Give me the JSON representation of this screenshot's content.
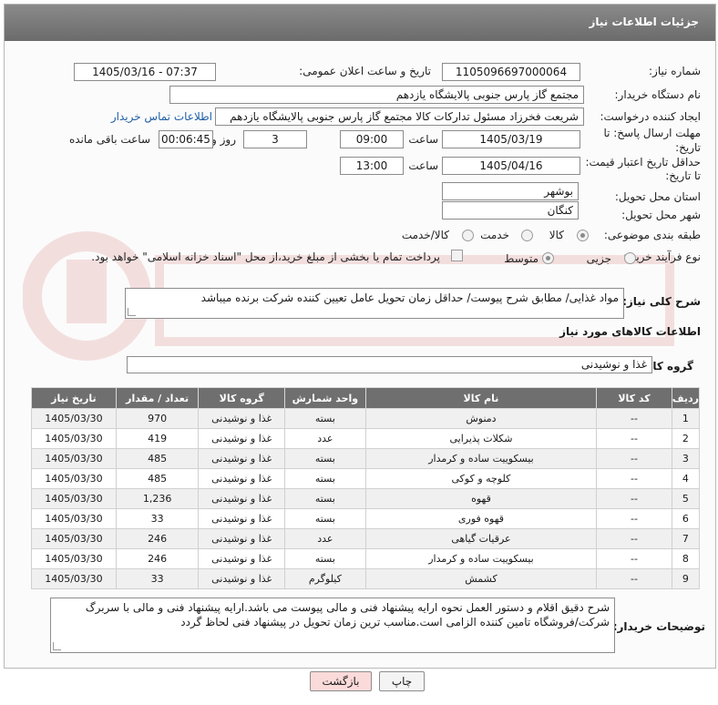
{
  "header": {
    "title": "جزئیات اطلاعات نیاز"
  },
  "form": {
    "need_number_label": "شماره نیاز:",
    "need_number": "1105096697000064",
    "announce_label": "تاریخ و ساعت اعلان عمومی:",
    "announce_value": "1405/03/16 - 07:37",
    "buyer_label": "نام دستگاه خریدار:",
    "buyer_value": "مجتمع گاز پارس جنوبی  پالایشگاه یازدهم",
    "creator_label": "ایجاد کننده درخواست:",
    "creator_value": "شریعت فخرزاد مسئول تدارکات کالا مجتمع گاز پارس جنوبی  پالایشگاه یازدهم",
    "contact_link": "اطلاعات تماس خریدار",
    "deadline_label_1": "مهلت ارسال پاسخ: تا",
    "deadline_label_2": "تاریخ:",
    "deadline_date": "1405/03/19",
    "time_label": "ساعت",
    "deadline_time": "09:00",
    "days_value": "3",
    "days_label": "روز و",
    "remaining_value": "00:06:45",
    "remaining_label": "ساعت باقی مانده",
    "validity_label_1": "حداقل تاریخ اعتبار قیمت:",
    "validity_label_2": "تا تاریخ:",
    "validity_date": "1405/04/16",
    "validity_time": "13:00",
    "province_label": "استان محل تحویل:",
    "province_value": "بوشهر",
    "city_label": "شهر محل تحویل:",
    "city_value": "کنگان",
    "category_label": "طبقه بندی موضوعی:",
    "category_options": [
      "کالا",
      "خدمت",
      "کالا/خدمت"
    ],
    "process_label": "نوع فرآیند خرید :",
    "process_options": [
      "جزیی",
      "متوسط"
    ],
    "payment_note": "پرداخت تمام یا بخشی از مبلغ خرید،از محل \"اسناد خزانه اسلامی\" خواهد بود."
  },
  "summary": {
    "label": "شرح کلی نیاز:",
    "value": "مواد غذایی/ مطابق شرح پیوست/ حداقل زمان تحویل عامل تعیین کننده شرکت برنده میباشد"
  },
  "goods": {
    "section_title": "اطلاعات کالاهای مورد نیاز",
    "group_label": "گروه کالا:",
    "group_value": "غذا و نوشیدنی",
    "columns": [
      "ردیف",
      "کد کالا",
      "نام کالا",
      "واحد شمارش",
      "گروه کالا",
      "تعداد / مقدار",
      "تاریخ نیاز"
    ],
    "rows": [
      [
        "1",
        "--",
        "دمنوش",
        "بسته",
        "غذا و نوشیدنی",
        "970",
        "1405/03/30"
      ],
      [
        "2",
        "--",
        "شکلات پذیرایی",
        "عدد",
        "غذا و نوشیدنی",
        "419",
        "1405/03/30"
      ],
      [
        "3",
        "--",
        "بیسکوییت ساده و کرمدار",
        "بسته",
        "غذا و نوشیدنی",
        "485",
        "1405/03/30"
      ],
      [
        "4",
        "--",
        "کلوچه و کوکی",
        "بسته",
        "غذا و نوشیدنی",
        "485",
        "1405/03/30"
      ],
      [
        "5",
        "--",
        "قهوه",
        "بسته",
        "غذا و نوشیدنی",
        "1,236",
        "1405/03/30"
      ],
      [
        "6",
        "--",
        "قهوه فوری",
        "بسته",
        "غذا و نوشیدنی",
        "33",
        "1405/03/30"
      ],
      [
        "7",
        "--",
        "عرقیات گیاهی",
        "عدد",
        "غذا و نوشیدنی",
        "246",
        "1405/03/30"
      ],
      [
        "8",
        "--",
        "بیسکوییت ساده و کرمدار",
        "بسته",
        "غذا و نوشیدنی",
        "246",
        "1405/03/30"
      ],
      [
        "9",
        "--",
        "کشمش",
        "کیلوگرم",
        "غذا و نوشیدنی",
        "33",
        "1405/03/30"
      ]
    ]
  },
  "buyer_notes": {
    "label": "توضیحات خریدار:",
    "value": "شرح دقیق اقلام و دستور العمل نحوه ارایه پیشنهاد فنی و مالی پیوست می باشد.ارایه پیشنهاد فنی و مالی با سربرگ شرکت/فروشگاه تامین کننده الزامی است.مناسب ترین زمان تحویل در پیشنهاد فنی لحاظ گردد"
  },
  "buttons": {
    "print": "چاپ",
    "back": "بازگشت"
  },
  "colors": {
    "header": "#737373",
    "link": "#1f5fa8",
    "back_button": "#fbdada",
    "print_button": "#f4f4f4"
  }
}
